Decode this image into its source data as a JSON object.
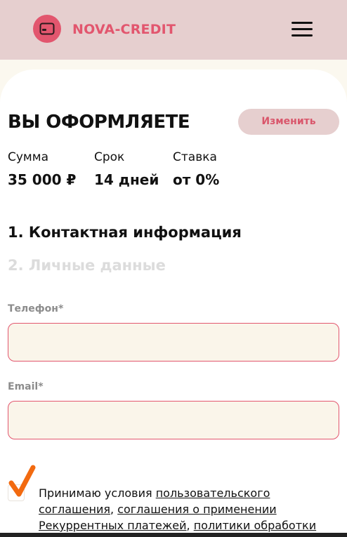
{
  "header": {
    "brand": "NOVA-CREDIT",
    "logo_icon": "credit-card-icon",
    "menu_icon": "hamburger-menu-icon",
    "background": "#e6cfcf",
    "accent": "#e2566e"
  },
  "summary": {
    "title": "ВЫ ОФОРМЛЯЕТЕ",
    "change_label": "Изменить",
    "amount_label": "Сумма",
    "amount_value": "35 000 ₽",
    "term_label": "Срок",
    "term_value": "14 дней",
    "rate_label": "Ставка",
    "rate_value": "от 0%"
  },
  "steps": {
    "active": "1. Контактная информация",
    "inactive": "2. Личные данные"
  },
  "form": {
    "phone_label": "Телефон*",
    "phone_value": "",
    "email_label": "Email*",
    "email_value": ""
  },
  "consent": {
    "checked": true,
    "text_prefix": "Принимаю условия ",
    "link1": "пользовательского соглашения",
    "sep1": ", ",
    "link2": "соглашения о применении Рекуррентных платежей",
    "sep2": ", ",
    "link3": "политики обработки"
  }
}
